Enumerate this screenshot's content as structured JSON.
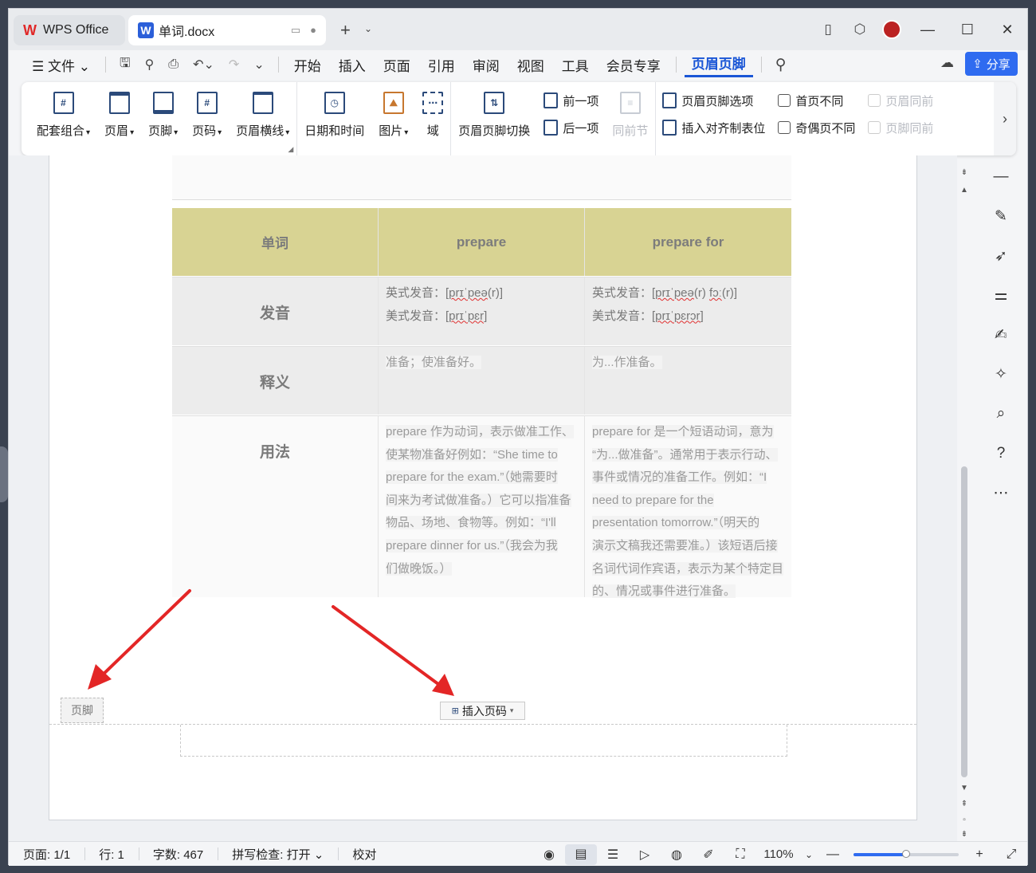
{
  "titlebar": {
    "app_tab": "WPS Office",
    "doc_tab": "单词.docx",
    "new_tab_icon": "plus-icon"
  },
  "menubar": {
    "file": "文件",
    "items": [
      "开始",
      "插入",
      "页面",
      "引用",
      "审阅",
      "视图",
      "工具",
      "会员专享",
      "页眉页脚"
    ],
    "active": "页眉页脚",
    "share": "分享"
  },
  "ribbon": {
    "buttons": [
      "配套组合",
      "页眉",
      "页脚",
      "页码",
      "页眉横线",
      "日期和时间",
      "图片",
      "域",
      "页眉页脚切换"
    ],
    "nav": {
      "prev": "前一项",
      "next": "后一项",
      "same_as_prev": "同前节"
    },
    "options": {
      "hf_options": "页眉页脚选项",
      "align_tab": "插入对齐制表位"
    },
    "checkboxes": {
      "first_diff": "首页不同",
      "odd_even_diff": "奇偶页不同",
      "header_same": "页眉同前",
      "footer_same": "页脚同前"
    }
  },
  "table": {
    "headers": [
      "单词",
      "prepare",
      "prepare for"
    ],
    "row_labels": [
      "发音",
      "释义",
      "用法"
    ],
    "pron": {
      "c2_l1_pre": "英式发音：[",
      "c2_l1_ipa": "prɪˈpeə",
      "c2_l1_post": "(r)]",
      "c2_l2_pre": "美式发音：[",
      "c2_l2_ipa": "prɪˈpɛr",
      "c2_l2_post": "]",
      "c3_l1_pre": "英式发音：[",
      "c3_l1_ipa": "prɪˈpeə",
      "c3_l1_mid": "(r) ",
      "c3_l1_ipa2": "fɔː",
      "c3_l1_post": "(r)]",
      "c3_l2_pre": "美式发音：[",
      "c3_l2_ipa": "prɪˈpɛrɔr",
      "c3_l2_post": "]"
    },
    "meaning": [
      "准备；使准备好。",
      "为...作准备。"
    ],
    "usage_prepare": [
      "prepare  作为动词，表示做准工作、",
      "使某物准备好例如：“She time to",
      "prepare for the exam.”（她需要时",
      "间来为考试做准备。）它可以指准备",
      "物品、场地、食物等。例如：“I'll",
      "prepare dinner for us.”（我会为我",
      "们做晚饭。）"
    ],
    "usage_prepare_for": [
      "prepare for  是一个短语动词，意为",
      "“为...做准备”。通常用于表示行动、",
      "事件或情况的准备工作。例如：“I",
      "need to prepare for the",
      "presentation tomorrow.”（明天的",
      "演示文稿我还需要准。）该短语后接",
      "名词代词作宾语，表示为某个特定目",
      "的、情况或事件进行准备。"
    ]
  },
  "footer": {
    "label": "页脚",
    "insert_page_number": "插入页码"
  },
  "statusbar": {
    "page": "页面: 1/1",
    "line": "行: 1",
    "words": "字数: 467",
    "spell": "拼写检查: 打开",
    "proof": "校对",
    "zoom": "110%",
    "zoom_fraction": 0.5
  },
  "colors": {
    "accent": "#2f6bf0",
    "table_header": "#d8d393",
    "arrow": "#e32626"
  }
}
